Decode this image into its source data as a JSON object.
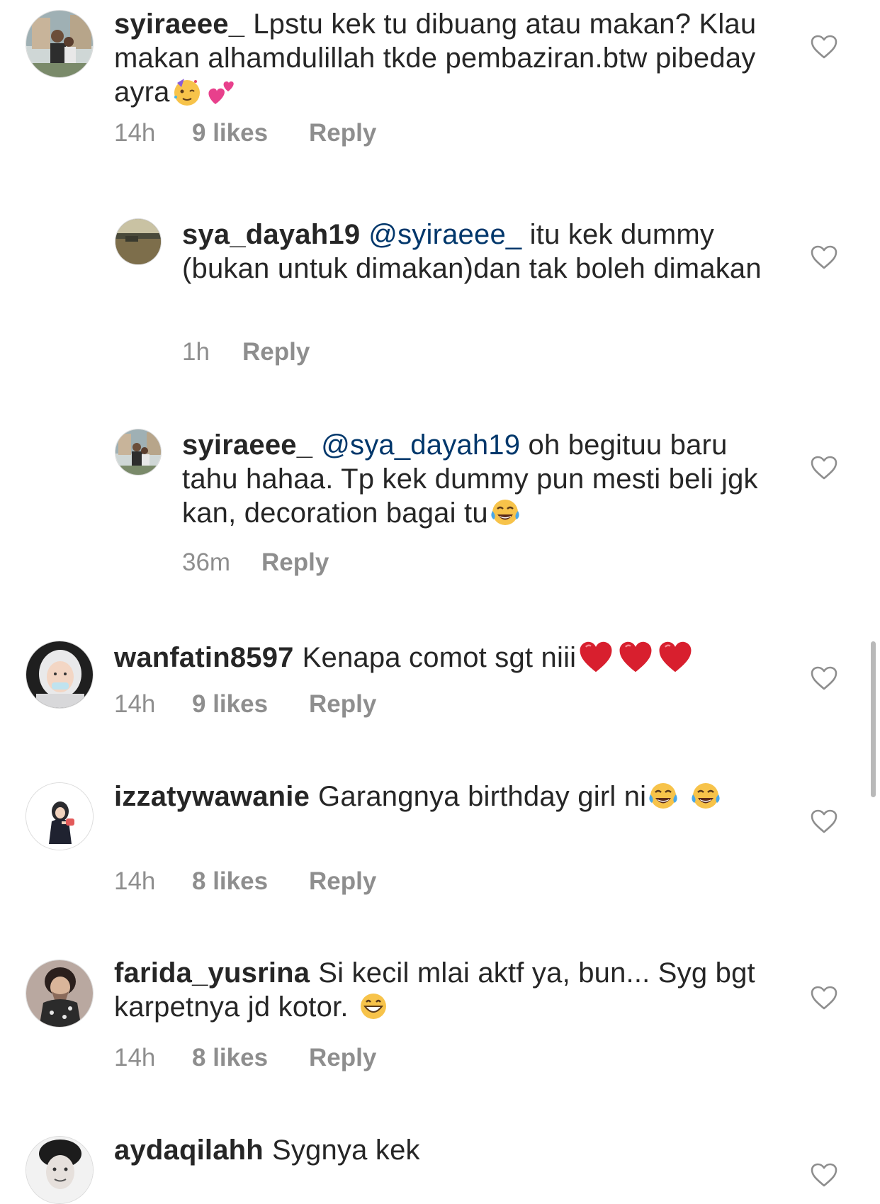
{
  "comments": [
    {
      "kind": "top",
      "username": "syiraeee_",
      "text_before": "Lpstu kek tu dibuang atau makan? Klau makan alhamdulillah tkde pembaziran.btw pibeday ayra",
      "emojis": [
        "partying-face-emoji",
        "two-hearts-emoji"
      ],
      "time": "14h",
      "likes": "9 likes",
      "reply_label": "Reply"
    },
    {
      "kind": "reply",
      "username": "sya_dayah19",
      "mention": "@syiraeee_",
      "text": "itu kek dummy (bukan untuk dimakan)dan tak boleh dimakan",
      "time": "1h",
      "reply_label": "Reply"
    },
    {
      "kind": "reply",
      "username": "syiraeee_",
      "mention": "@sya_dayah19",
      "text": "oh begituu baru tahu hahaa. Tp kek dummy pun mesti beli jgk kan, decoration bagai tu",
      "emojis": [
        "tears-of-joy-emoji"
      ],
      "time": "36m",
      "reply_label": "Reply"
    },
    {
      "kind": "top",
      "username": "wanfatin8597",
      "text_before": "Kenapa comot sgt niii",
      "emojis": [
        "red-heart-emoji",
        "red-heart-emoji",
        "red-heart-emoji"
      ],
      "time": "14h",
      "likes": "9 likes",
      "reply_label": "Reply"
    },
    {
      "kind": "top",
      "username": "izzatywawanie",
      "text_before": "Garangnya birthday girl ni",
      "emojis": [
        "tears-of-joy-emoji",
        "tears-of-joy-emoji"
      ],
      "time": "14h",
      "likes": "8 likes",
      "reply_label": "Reply"
    },
    {
      "kind": "top",
      "username": "farida_yusrina",
      "text_before": "Si kecil mlai aktf ya, bun... Syg bgt karpetnya jd kotor.",
      "emojis": [
        "grinning-face-emoji"
      ],
      "time": "14h",
      "likes": "8 likes",
      "reply_label": "Reply"
    },
    {
      "kind": "top",
      "username": "aydaqilahh",
      "text_before": "Sygnya kek"
    }
  ],
  "colors": {
    "text": "#262626",
    "meta": "#8e8e8e",
    "mention": "#00376b",
    "heart_outline": "#8e8e8e"
  },
  "icons": {
    "like": "heart-outline-icon"
  }
}
